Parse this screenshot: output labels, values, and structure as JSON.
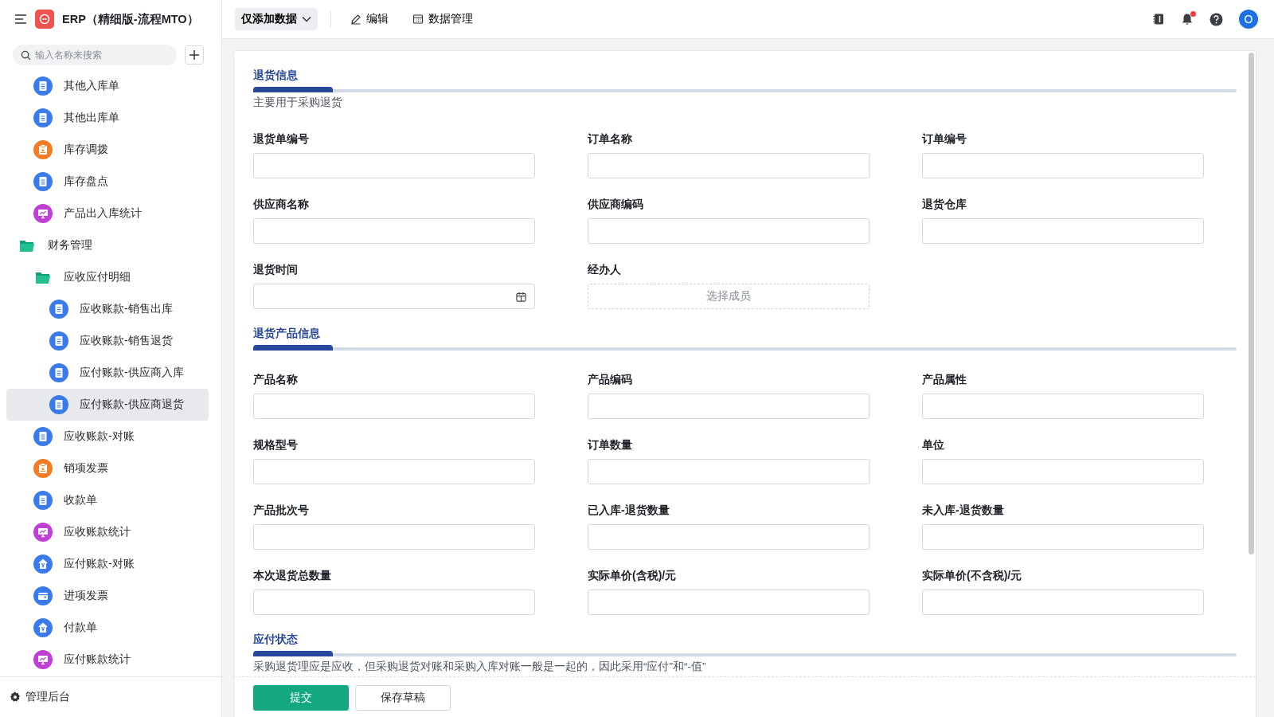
{
  "app": {
    "title": "ERP（精细版-流程MTO）"
  },
  "sidebar": {
    "search": {
      "placeholder": "输入名称来搜索"
    },
    "items": [
      {
        "label": "其他入库单",
        "kind": "doc",
        "selected": false
      },
      {
        "label": "其他出库单",
        "kind": "doc",
        "selected": false
      },
      {
        "label": "库存调拨",
        "kind": "clipboard",
        "selected": false
      },
      {
        "label": "库存盘点",
        "kind": "doc",
        "selected": false
      },
      {
        "label": "产品出入库统计",
        "kind": "chart",
        "selected": false
      },
      {
        "label": "财务管理",
        "kind": "folder",
        "expanded": true,
        "children": [
          {
            "label": "应收应付明细",
            "kind": "folder",
            "expanded": true,
            "children": [
              {
                "label": "应收账款-销售出库",
                "kind": "doc",
                "selected": false
              },
              {
                "label": "应收账款-销售退货",
                "kind": "doc",
                "selected": false
              },
              {
                "label": "应付账款-供应商入库",
                "kind": "doc",
                "selected": false
              },
              {
                "label": "应付账款-供应商退货",
                "kind": "doc",
                "selected": true
              }
            ]
          },
          {
            "label": "应收账款-对账",
            "kind": "doc",
            "selected": false
          },
          {
            "label": "销项发票",
            "kind": "clipboard",
            "selected": false
          },
          {
            "label": "收款单",
            "kind": "doc",
            "selected": false
          },
          {
            "label": "应收账款统计",
            "kind": "chart",
            "selected": false
          },
          {
            "label": "应付账款-对账",
            "kind": "yen",
            "selected": false
          },
          {
            "label": "进项发票",
            "kind": "card",
            "selected": false
          },
          {
            "label": "付款单",
            "kind": "yen",
            "selected": false
          },
          {
            "label": "应付账款统计",
            "kind": "chart",
            "selected": false
          }
        ]
      }
    ],
    "footer": "管理后台"
  },
  "toolbar": {
    "view_menu": "仅添加数据",
    "actions": [
      {
        "label": "编辑",
        "kind": "edit"
      },
      {
        "label": "数据管理",
        "kind": "table"
      }
    ],
    "notifications_unread": true,
    "avatar": "O"
  },
  "form": {
    "sections": [
      {
        "title": "退货信息",
        "description": "主要用于采购退货",
        "fields": [
          {
            "label": "退货单编号",
            "kind": "text"
          },
          {
            "label": "订单名称",
            "kind": "text"
          },
          {
            "label": "订单编号",
            "kind": "text"
          },
          {
            "label": "供应商名称",
            "kind": "text"
          },
          {
            "label": "供应商编码",
            "kind": "text"
          },
          {
            "label": "退货仓库",
            "kind": "text"
          },
          {
            "label": "退货时间",
            "kind": "date"
          },
          {
            "label": "经办人",
            "kind": "member",
            "placeholder": "选择成员"
          }
        ]
      },
      {
        "title": "退货产品信息",
        "fields": [
          {
            "label": "产品名称",
            "kind": "text"
          },
          {
            "label": "产品编码",
            "kind": "text"
          },
          {
            "label": "产品属性",
            "kind": "text"
          },
          {
            "label": "规格型号",
            "kind": "text"
          },
          {
            "label": "订单数量",
            "kind": "text"
          },
          {
            "label": "单位",
            "kind": "text"
          },
          {
            "label": "产品批次号",
            "kind": "text"
          },
          {
            "label": "已入库-退货数量",
            "kind": "text"
          },
          {
            "label": "未入库-退货数量",
            "kind": "text"
          },
          {
            "label": "本次退货总数量",
            "kind": "text"
          },
          {
            "label": "实际单价(含税)/元",
            "kind": "text"
          },
          {
            "label": "实际单价(不含税)/元",
            "kind": "text"
          }
        ]
      },
      {
        "title": "应付状态",
        "description": "采购退货理应是应收，但采购退货对账和采购入库对账一般是一起的，因此采用“应付”和“-值”"
      }
    ],
    "buttons": [
      {
        "label": "提交",
        "kind": "primary"
      },
      {
        "label": "保存草稿",
        "kind": "default"
      }
    ]
  }
}
